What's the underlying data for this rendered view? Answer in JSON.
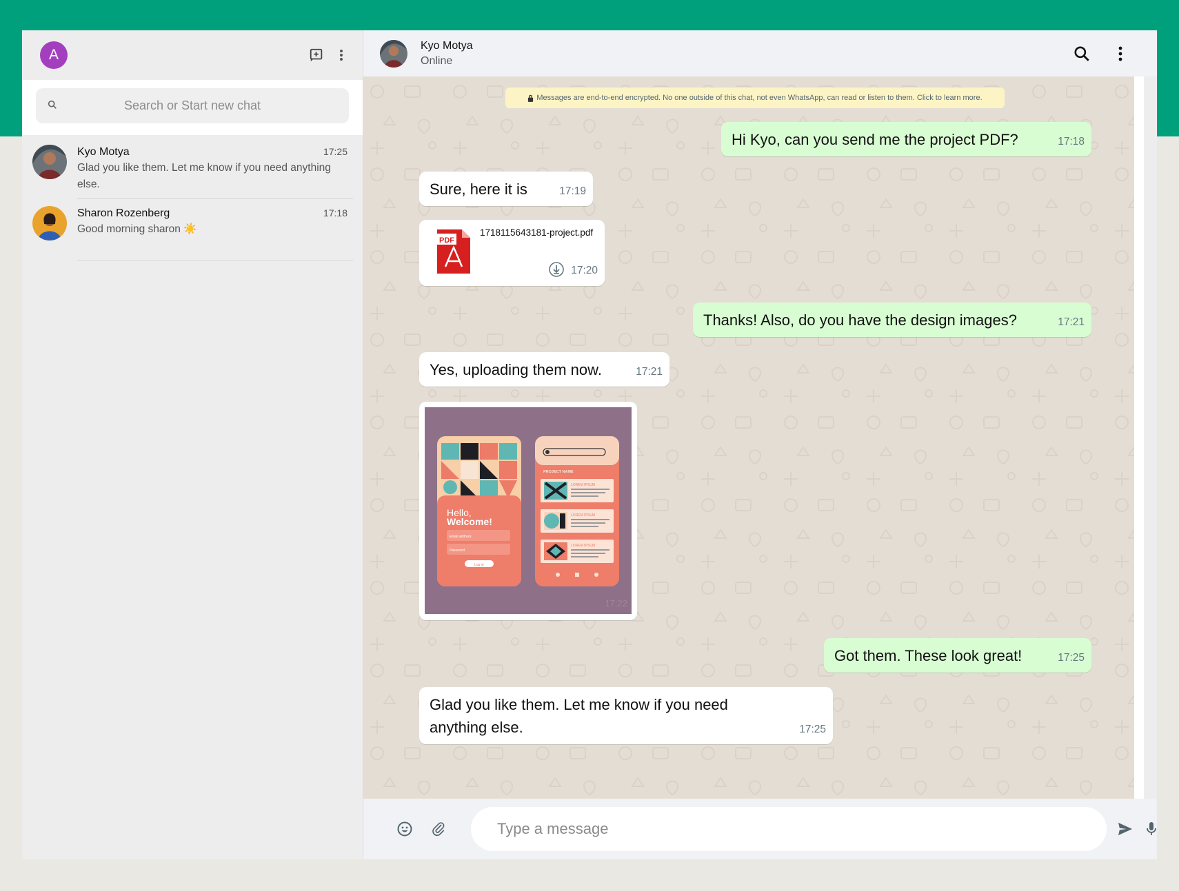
{
  "colors": {
    "brand_band": "#00a07c",
    "outgoing_bubble": "#d9fdd3",
    "incoming_bubble": "#ffffff",
    "chat_background": "#e4ddd4",
    "avatar_me": "#a33ebf"
  },
  "sidebar": {
    "me_initial": "A",
    "actions": [
      "new-chat-icon",
      "more-vert-icon"
    ],
    "search": {
      "placeholder": "Search or Start new chat",
      "value": ""
    },
    "chats": [
      {
        "name": "Kyo Motya",
        "time": "17:25",
        "last": "Glad you like them. Let me know if you need anything else."
      },
      {
        "name": "Sharon Rozenberg",
        "time": "17:18",
        "last": "Good morning sharon ☀️"
      }
    ]
  },
  "conversation": {
    "contact_name": "Kyo Motya",
    "contact_status": "Online",
    "actions": [
      "search-icon",
      "more-vert-icon"
    ],
    "encryption_notice": "Messages are end-to-end encrypted. No one outside of this chat, not even WhatsApp, can read or listen to them. Click to learn more.",
    "messages": [
      {
        "dir": "out",
        "type": "text",
        "text": "Hi Kyo, can you send me the project PDF?",
        "time": "17:18"
      },
      {
        "dir": "in",
        "type": "text",
        "text": "Sure, here it is",
        "time": "17:19"
      },
      {
        "dir": "in",
        "type": "file",
        "file_name": "1718115643181-project.pdf",
        "file_badge": "PDF",
        "time": "17:20"
      },
      {
        "dir": "out",
        "type": "text",
        "text": "Thanks! Also, do you have the design images?",
        "time": "17:21"
      },
      {
        "dir": "in",
        "type": "text",
        "text": "Yes, uploading them now.",
        "time": "17:21"
      },
      {
        "dir": "in",
        "type": "image",
        "time": "17:22",
        "image_text": {
          "greeting": "Hello,",
          "welcome": "Welcome!",
          "email": "Email address",
          "password": "Password",
          "login": "Log in",
          "project": "PROJECT NAME",
          "lorem": "LOREM IPSUM"
        }
      },
      {
        "dir": "out",
        "type": "text",
        "text": "Got them. These look great!",
        "time": "17:25"
      },
      {
        "dir": "in",
        "type": "text",
        "text_line1": "Glad you like them. Let me know if you need",
        "text_line2": "anything else.",
        "time": "17:25"
      }
    ]
  },
  "composer": {
    "placeholder": "Type a message",
    "value": "",
    "icons": [
      "emoji-icon",
      "attach-icon",
      "send-icon",
      "mic-icon"
    ]
  }
}
